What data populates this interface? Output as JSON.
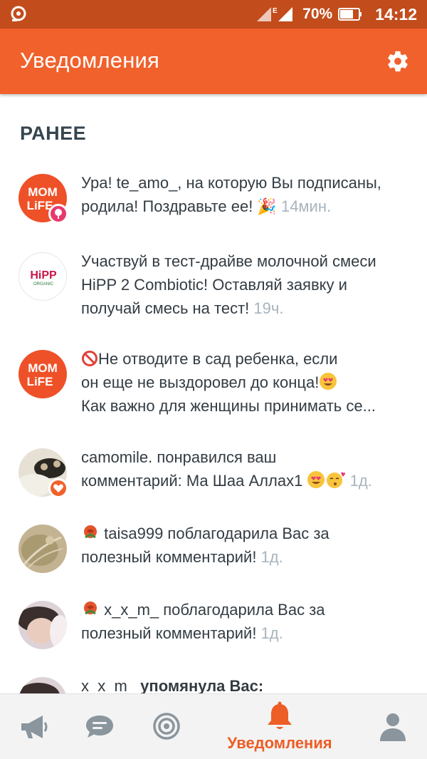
{
  "status_bar": {
    "network_type": "E",
    "battery": "70%",
    "time": "14:12"
  },
  "header": {
    "title": "Уведомления",
    "settings_icon": "gear-icon"
  },
  "section": {
    "title": "РАНЕЕ"
  },
  "notifications": [
    {
      "avatar_text": [
        "MOM",
        "LiFE"
      ],
      "line1": "Ура! te_amo_, на которую Вы подписаны,",
      "line2": "родила! Поздравьте ее! 🎉",
      "time": "14мин."
    },
    {
      "avatar_text": [
        "HiPP",
        "ORGANIC"
      ],
      "line1": "Участвуй в тест-драйве молочной смеси",
      "line2": "HiPP 2 Combiotic! Оставляй заявку и",
      "line3": "получай смесь на тест!",
      "time": "19ч."
    },
    {
      "avatar_text": [
        "MOM",
        "LiFE"
      ],
      "line1": "Не отводите в сад ребенка, если",
      "line2": "он еще не выздоровел до конца!",
      "line3": "Как важно для женщины принимать се..."
    },
    {
      "line1": "camomile. понравился ваш",
      "line2": "комментарий: Ма Шаа Аллах1",
      "time": "1д."
    },
    {
      "line1": "taisa999 поблагодарила Вас за",
      "line2": "полезный комментарий!",
      "time": "1д."
    },
    {
      "line1": "x_x_m_ поблагодарила Вас за",
      "line2": "полезный комментарий!",
      "time": "1д."
    },
    {
      "user": "x_x_m_",
      "action": "упомянула Вас:"
    }
  ],
  "bottom_nav": {
    "items": [
      {
        "icon": "megaphone-icon"
      },
      {
        "icon": "chat-icon"
      },
      {
        "icon": "target-icon"
      },
      {
        "icon": "bell-icon",
        "label": "Уведомления",
        "active": true
      },
      {
        "icon": "profile-icon"
      }
    ]
  },
  "colors": {
    "status_bar": "#c24c1c",
    "app_bar": "#f1612b",
    "accent": "#ed5d26",
    "text": "#333c43",
    "time": "#a7b4bd",
    "nav_inactive": "#8a959d"
  }
}
